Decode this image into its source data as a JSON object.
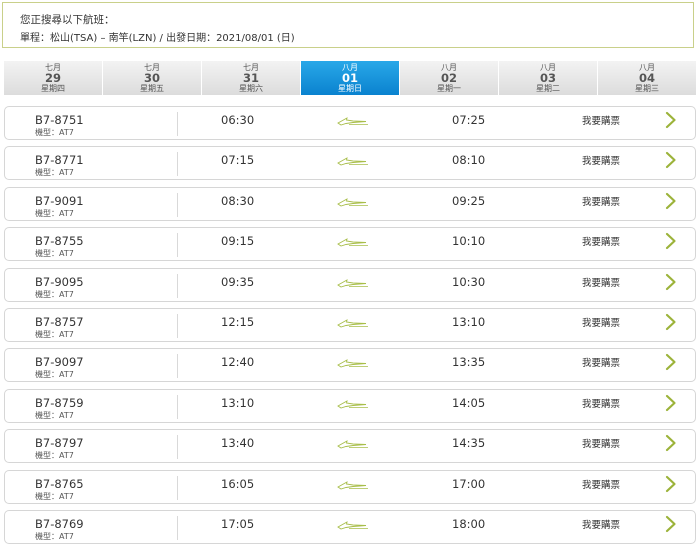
{
  "search": {
    "title": "您正搜尋以下航班：",
    "route": "單程：松山(TSA) – 南竿(LZN)  /  出發日期：2021/08/01 (日)"
  },
  "dates": [
    {
      "month": "七月",
      "day": "29",
      "weekday": "星期四",
      "active": false
    },
    {
      "month": "七月",
      "day": "30",
      "weekday": "星期五",
      "active": false
    },
    {
      "month": "七月",
      "day": "31",
      "weekday": "星期六",
      "active": false
    },
    {
      "month": "八月",
      "day": "01",
      "weekday": "星期日",
      "active": true
    },
    {
      "month": "八月",
      "day": "02",
      "weekday": "星期一",
      "active": false
    },
    {
      "month": "八月",
      "day": "03",
      "weekday": "星期二",
      "active": false
    },
    {
      "month": "八月",
      "day": "04",
      "weekday": "星期三",
      "active": false
    }
  ],
  "flights": [
    {
      "number": "B7-8751",
      "type": "機型：AT7",
      "depart": "06:30",
      "arrive": "07:25",
      "action": "我要購票"
    },
    {
      "number": "B7-8771",
      "type": "機型：AT7",
      "depart": "07:15",
      "arrive": "08:10",
      "action": "我要購票"
    },
    {
      "number": "B7-9091",
      "type": "機型：AT7",
      "depart": "08:30",
      "arrive": "09:25",
      "action": "我要購票"
    },
    {
      "number": "B7-8755",
      "type": "機型：AT7",
      "depart": "09:15",
      "arrive": "10:10",
      "action": "我要購票"
    },
    {
      "number": "B7-9095",
      "type": "機型：AT7",
      "depart": "09:35",
      "arrive": "10:30",
      "action": "我要購票"
    },
    {
      "number": "B7-8757",
      "type": "機型：AT7",
      "depart": "12:15",
      "arrive": "13:10",
      "action": "我要購票"
    },
    {
      "number": "B7-9097",
      "type": "機型：AT7",
      "depart": "12:40",
      "arrive": "13:35",
      "action": "我要購票"
    },
    {
      "number": "B7-8759",
      "type": "機型：AT7",
      "depart": "13:10",
      "arrive": "14:05",
      "action": "我要購票"
    },
    {
      "number": "B7-8797",
      "type": "機型：AT7",
      "depart": "13:40",
      "arrive": "14:35",
      "action": "我要購票"
    },
    {
      "number": "B7-8765",
      "type": "機型：AT7",
      "depart": "16:05",
      "arrive": "17:00",
      "action": "我要購票"
    },
    {
      "number": "B7-8769",
      "type": "機型：AT7",
      "depart": "17:05",
      "arrive": "18:00",
      "action": "我要購票"
    }
  ],
  "colors": {
    "accent": "#0a82cf",
    "icon": "#9cb33a",
    "border": "#c9d08a"
  },
  "icons": {
    "flight": "airplane-icon",
    "row_action": "chevron-right-icon"
  }
}
